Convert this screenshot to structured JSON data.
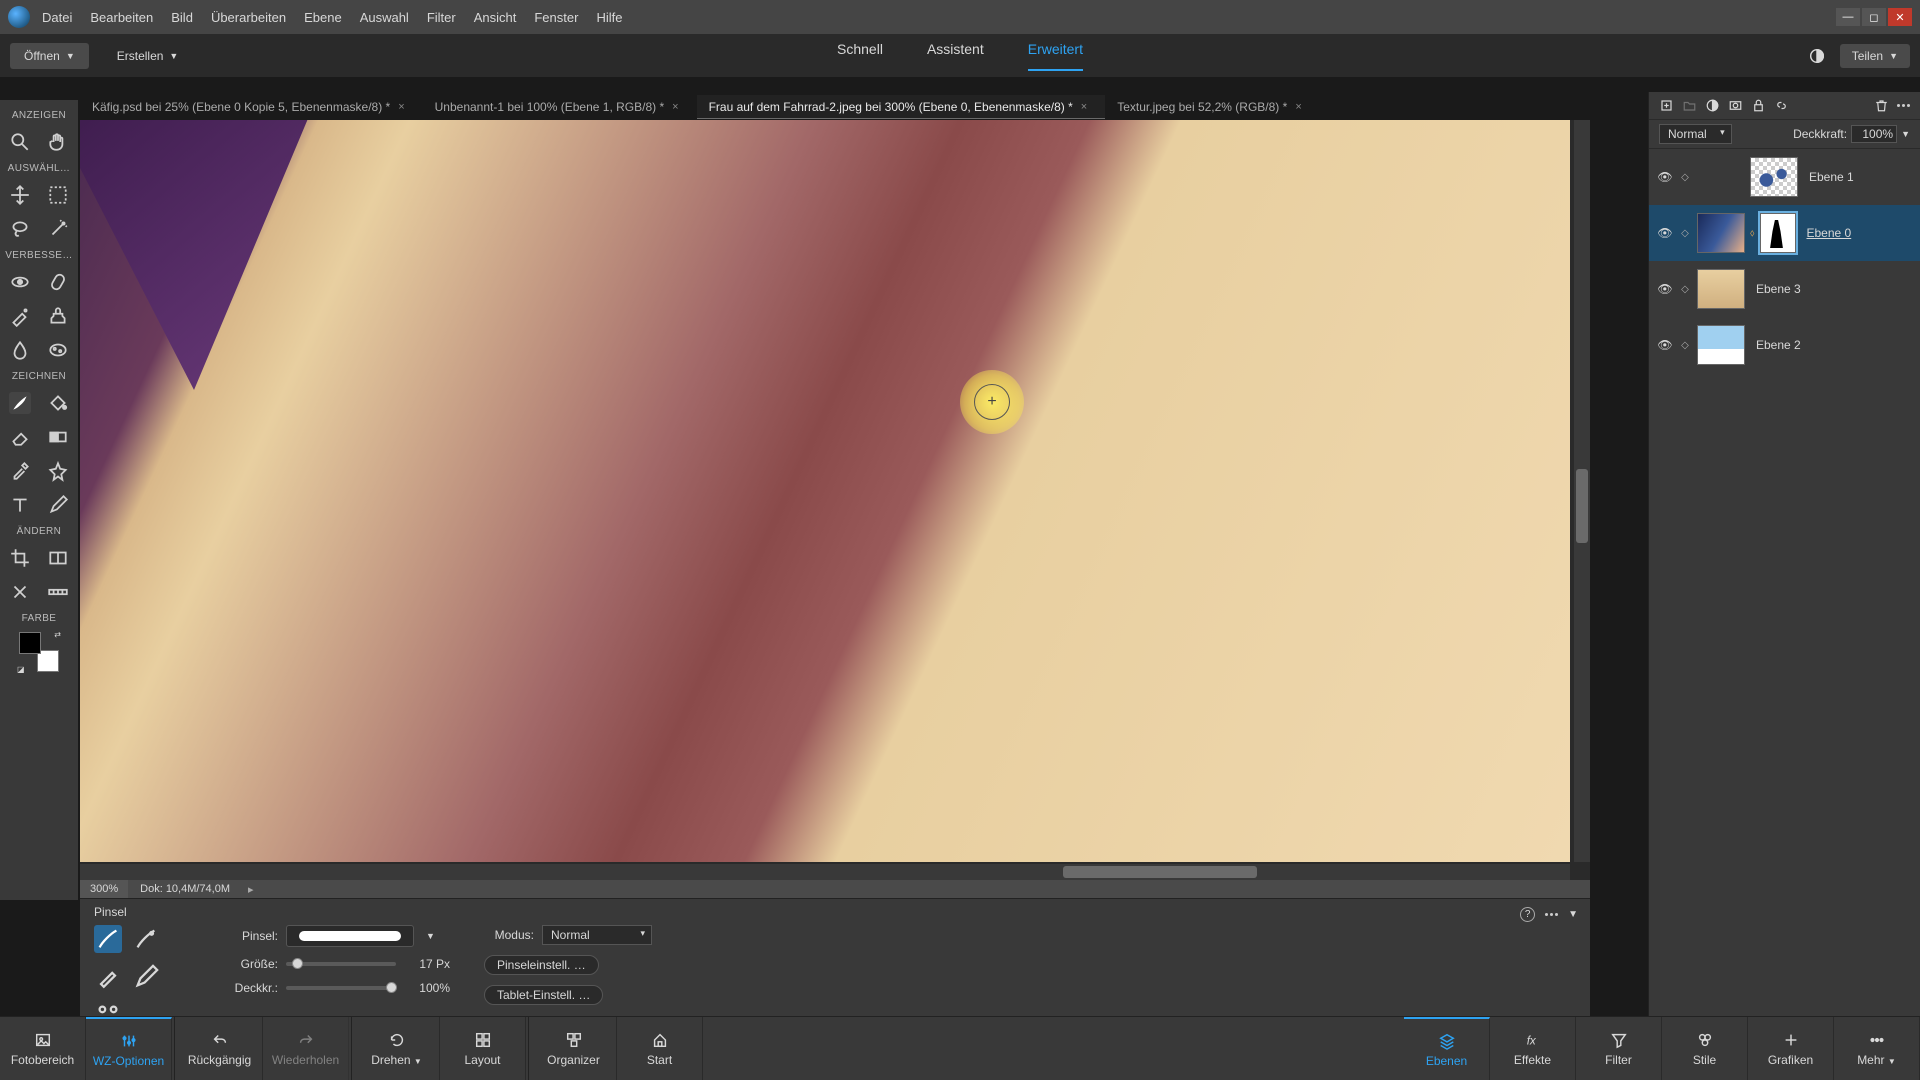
{
  "menu": [
    "Datei",
    "Bearbeiten",
    "Bild",
    "Überarbeiten",
    "Ebene",
    "Auswahl",
    "Filter",
    "Ansicht",
    "Fenster",
    "Hilfe"
  ],
  "optionbar": {
    "open": "Öffnen",
    "create": "Erstellen",
    "share": "Teilen"
  },
  "modes": {
    "quick": "Schnell",
    "guided": "Assistent",
    "expert": "Erweitert"
  },
  "doctabs": [
    "Käfig.psd bei 25% (Ebene 0 Kopie 5, Ebenenmaske/8) *",
    "Unbenannt-1 bei 100% (Ebene 1, RGB/8) *",
    "Frau auf dem Fahrrad-2.jpeg bei 300% (Ebene 0, Ebenenmaske/8) *",
    "Textur.jpeg bei 52,2% (RGB/8) *"
  ],
  "tool_sections": {
    "view": "ANZEIGEN",
    "select": "AUSWÄHL…",
    "enhance": "VERBESSE…",
    "draw": "ZEICHNEN",
    "modify": "ÄNDERN",
    "color": "FARBE"
  },
  "status": {
    "zoom": "300%",
    "doc": "Dok: 10,4M/74,0M"
  },
  "layers_panel": {
    "blend": "Normal",
    "opacity_label": "Deckkraft:",
    "opacity_value": "100%",
    "items": [
      {
        "name": "Ebene 1",
        "underline": false
      },
      {
        "name": "Ebene 0",
        "underline": true
      },
      {
        "name": "Ebene 3",
        "underline": false
      },
      {
        "name": "Ebene 2",
        "underline": false
      }
    ]
  },
  "tool_options": {
    "title": "Pinsel",
    "brush_label": "Pinsel:",
    "mode_label": "Modus:",
    "mode_value": "Normal",
    "size_label": "Größe:",
    "size_value": "17 Px",
    "opacity_label": "Deckkr.:",
    "opacity_value": "100%",
    "btn_brush": "Pinseleinstell. …",
    "btn_tablet": "Tablet-Einstell. …"
  },
  "bottombar": {
    "left": [
      {
        "label": "Fotobereich",
        "icon": "image"
      },
      {
        "label": "WZ-Optionen",
        "icon": "sliders",
        "active": true
      },
      {
        "label": "Rückgängig",
        "icon": "undo"
      },
      {
        "label": "Wiederholen",
        "icon": "redo",
        "disabled": true
      },
      {
        "label": "Drehen",
        "icon": "rotate"
      },
      {
        "label": "Layout",
        "icon": "grid"
      },
      {
        "label": "Organizer",
        "icon": "boxes"
      },
      {
        "label": "Start",
        "icon": "home"
      }
    ],
    "right": [
      {
        "label": "Ebenen",
        "icon": "layers",
        "active": true
      },
      {
        "label": "Effekte",
        "icon": "fx"
      },
      {
        "label": "Filter",
        "icon": "funnel"
      },
      {
        "label": "Stile",
        "icon": "styles"
      },
      {
        "label": "Grafiken",
        "icon": "plus"
      },
      {
        "label": "Mehr",
        "icon": "more"
      }
    ]
  }
}
